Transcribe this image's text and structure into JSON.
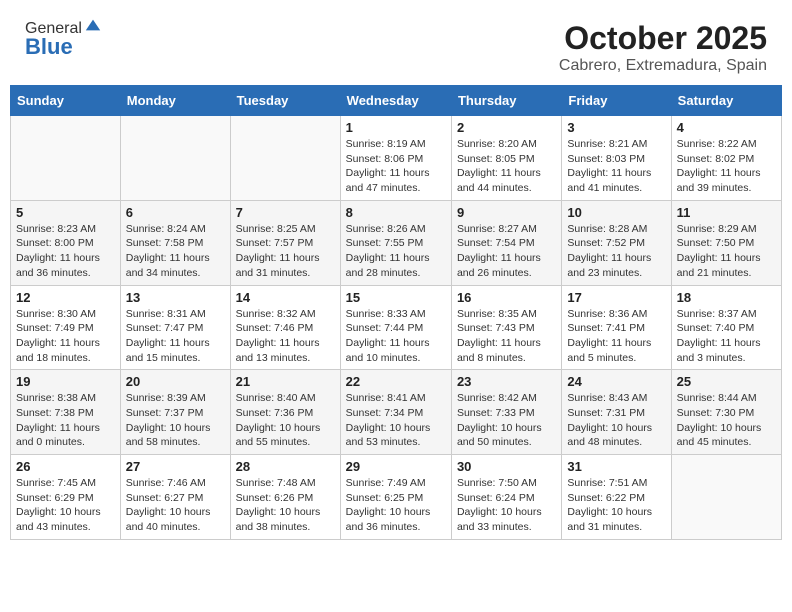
{
  "header": {
    "logo_general": "General",
    "logo_blue": "Blue",
    "title": "October 2025",
    "subtitle": "Cabrero, Extremadura, Spain"
  },
  "calendar": {
    "days_of_week": [
      "Sunday",
      "Monday",
      "Tuesday",
      "Wednesday",
      "Thursday",
      "Friday",
      "Saturday"
    ],
    "weeks": [
      [
        {
          "day": "",
          "info": ""
        },
        {
          "day": "",
          "info": ""
        },
        {
          "day": "",
          "info": ""
        },
        {
          "day": "1",
          "info": "Sunrise: 8:19 AM\nSunset: 8:06 PM\nDaylight: 11 hours and 47 minutes."
        },
        {
          "day": "2",
          "info": "Sunrise: 8:20 AM\nSunset: 8:05 PM\nDaylight: 11 hours and 44 minutes."
        },
        {
          "day": "3",
          "info": "Sunrise: 8:21 AM\nSunset: 8:03 PM\nDaylight: 11 hours and 41 minutes."
        },
        {
          "day": "4",
          "info": "Sunrise: 8:22 AM\nSunset: 8:02 PM\nDaylight: 11 hours and 39 minutes."
        }
      ],
      [
        {
          "day": "5",
          "info": "Sunrise: 8:23 AM\nSunset: 8:00 PM\nDaylight: 11 hours and 36 minutes."
        },
        {
          "day": "6",
          "info": "Sunrise: 8:24 AM\nSunset: 7:58 PM\nDaylight: 11 hours and 34 minutes."
        },
        {
          "day": "7",
          "info": "Sunrise: 8:25 AM\nSunset: 7:57 PM\nDaylight: 11 hours and 31 minutes."
        },
        {
          "day": "8",
          "info": "Sunrise: 8:26 AM\nSunset: 7:55 PM\nDaylight: 11 hours and 28 minutes."
        },
        {
          "day": "9",
          "info": "Sunrise: 8:27 AM\nSunset: 7:54 PM\nDaylight: 11 hours and 26 minutes."
        },
        {
          "day": "10",
          "info": "Sunrise: 8:28 AM\nSunset: 7:52 PM\nDaylight: 11 hours and 23 minutes."
        },
        {
          "day": "11",
          "info": "Sunrise: 8:29 AM\nSunset: 7:50 PM\nDaylight: 11 hours and 21 minutes."
        }
      ],
      [
        {
          "day": "12",
          "info": "Sunrise: 8:30 AM\nSunset: 7:49 PM\nDaylight: 11 hours and 18 minutes."
        },
        {
          "day": "13",
          "info": "Sunrise: 8:31 AM\nSunset: 7:47 PM\nDaylight: 11 hours and 15 minutes."
        },
        {
          "day": "14",
          "info": "Sunrise: 8:32 AM\nSunset: 7:46 PM\nDaylight: 11 hours and 13 minutes."
        },
        {
          "day": "15",
          "info": "Sunrise: 8:33 AM\nSunset: 7:44 PM\nDaylight: 11 hours and 10 minutes."
        },
        {
          "day": "16",
          "info": "Sunrise: 8:35 AM\nSunset: 7:43 PM\nDaylight: 11 hours and 8 minutes."
        },
        {
          "day": "17",
          "info": "Sunrise: 8:36 AM\nSunset: 7:41 PM\nDaylight: 11 hours and 5 minutes."
        },
        {
          "day": "18",
          "info": "Sunrise: 8:37 AM\nSunset: 7:40 PM\nDaylight: 11 hours and 3 minutes."
        }
      ],
      [
        {
          "day": "19",
          "info": "Sunrise: 8:38 AM\nSunset: 7:38 PM\nDaylight: 11 hours and 0 minutes."
        },
        {
          "day": "20",
          "info": "Sunrise: 8:39 AM\nSunset: 7:37 PM\nDaylight: 10 hours and 58 minutes."
        },
        {
          "day": "21",
          "info": "Sunrise: 8:40 AM\nSunset: 7:36 PM\nDaylight: 10 hours and 55 minutes."
        },
        {
          "day": "22",
          "info": "Sunrise: 8:41 AM\nSunset: 7:34 PM\nDaylight: 10 hours and 53 minutes."
        },
        {
          "day": "23",
          "info": "Sunrise: 8:42 AM\nSunset: 7:33 PM\nDaylight: 10 hours and 50 minutes."
        },
        {
          "day": "24",
          "info": "Sunrise: 8:43 AM\nSunset: 7:31 PM\nDaylight: 10 hours and 48 minutes."
        },
        {
          "day": "25",
          "info": "Sunrise: 8:44 AM\nSunset: 7:30 PM\nDaylight: 10 hours and 45 minutes."
        }
      ],
      [
        {
          "day": "26",
          "info": "Sunrise: 7:45 AM\nSunset: 6:29 PM\nDaylight: 10 hours and 43 minutes."
        },
        {
          "day": "27",
          "info": "Sunrise: 7:46 AM\nSunset: 6:27 PM\nDaylight: 10 hours and 40 minutes."
        },
        {
          "day": "28",
          "info": "Sunrise: 7:48 AM\nSunset: 6:26 PM\nDaylight: 10 hours and 38 minutes."
        },
        {
          "day": "29",
          "info": "Sunrise: 7:49 AM\nSunset: 6:25 PM\nDaylight: 10 hours and 36 minutes."
        },
        {
          "day": "30",
          "info": "Sunrise: 7:50 AM\nSunset: 6:24 PM\nDaylight: 10 hours and 33 minutes."
        },
        {
          "day": "31",
          "info": "Sunrise: 7:51 AM\nSunset: 6:22 PM\nDaylight: 10 hours and 31 minutes."
        },
        {
          "day": "",
          "info": ""
        }
      ]
    ]
  }
}
